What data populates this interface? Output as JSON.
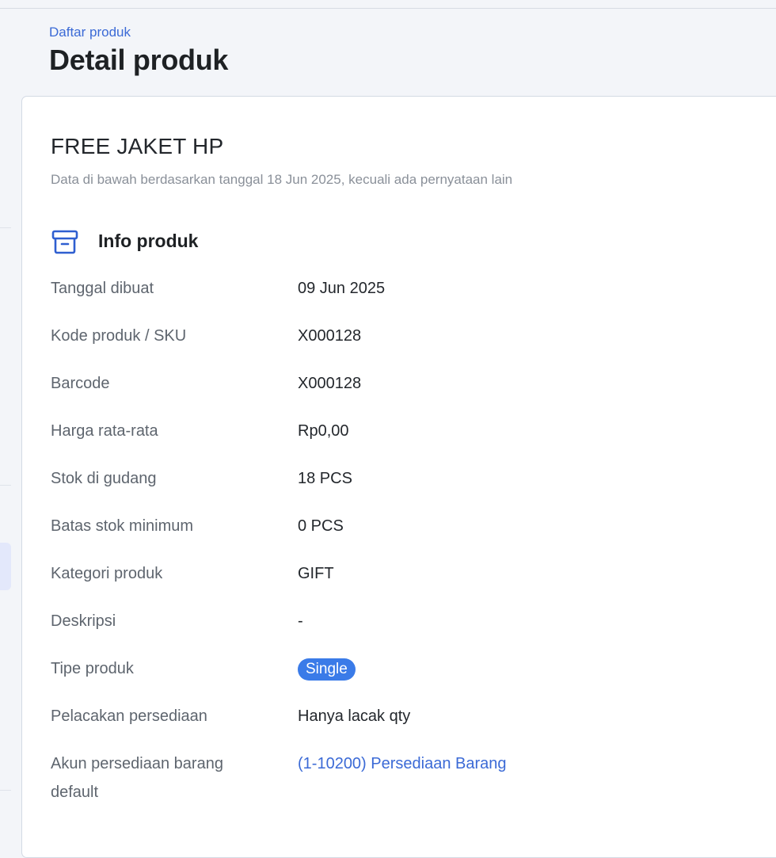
{
  "breadcrumb": "Daftar produk",
  "page_title": "Detail produk",
  "product": {
    "name": "FREE JAKET HP",
    "data_note": "Data di bawah berdasarkan tanggal 18 Jun 2025, kecuali ada pernyataan lain"
  },
  "section": {
    "title": "Info produk",
    "icon": "archive-box-icon"
  },
  "info_rows": [
    {
      "label": "Tanggal dibuat",
      "value": "09 Jun 2025"
    },
    {
      "label": "Kode produk / SKU",
      "value": "X000128"
    },
    {
      "label": "Barcode",
      "value": "X000128"
    },
    {
      "label": "Harga rata-rata",
      "value": "Rp0,00"
    },
    {
      "label": "Stok di gudang",
      "value": "18 PCS"
    },
    {
      "label": "Batas stok minimum",
      "value": "0 PCS"
    },
    {
      "label": "Kategori produk",
      "value": "GIFT"
    },
    {
      "label": "Deskripsi",
      "value": "-"
    },
    {
      "label": "Tipe produk",
      "value": "Single"
    },
    {
      "label": "Pelacakan persediaan",
      "value": "Hanya lacak qty"
    },
    {
      "label": "Akun persediaan barang default",
      "value": "(1-10200) Persediaan Barang"
    }
  ],
  "colors": {
    "accent": "#3b6ad6",
    "badge": "#3a7be8",
    "background": "#f3f5f9"
  }
}
